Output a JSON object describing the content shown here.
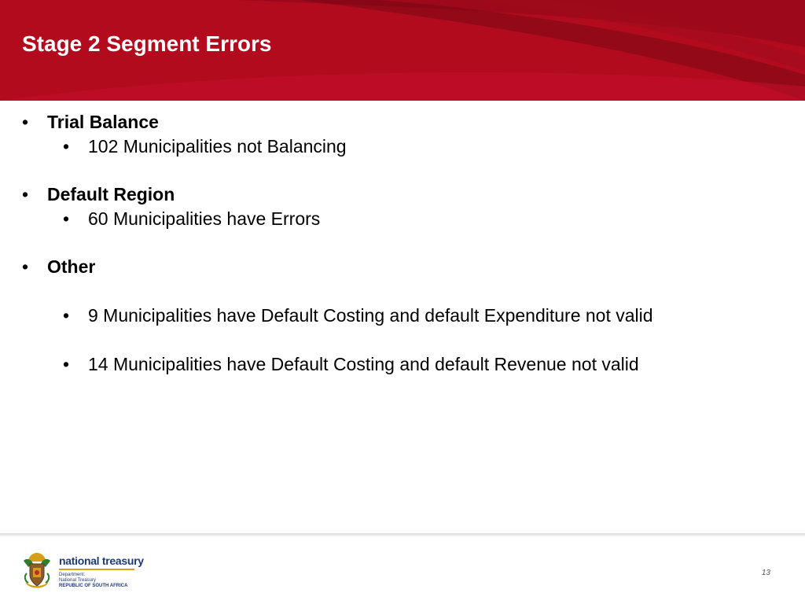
{
  "slide": {
    "title": "Stage 2 Segment Errors",
    "bullet_glyph": "•",
    "items": [
      {
        "heading": "Trial Balance",
        "subitems": [
          "102 Municipalities not Balancing"
        ]
      },
      {
        "heading": "Default Region",
        "subitems": [
          "60 Municipalities have Errors"
        ]
      },
      {
        "heading": "Other",
        "subitems": [
          "9 Municipalities have Default Costing and default Expenditure not valid",
          "14 Municipalities have Default Costing and default Revenue not valid"
        ]
      }
    ]
  },
  "footer": {
    "logo_name": "national treasury",
    "logo_line1": "Department:",
    "logo_line2": "National Treasury",
    "logo_line3": "REPUBLIC OF SOUTH AFRICA",
    "page_number": "13"
  },
  "colors": {
    "header_red": "#b20b1e",
    "header_dark_red": "#8c0a18",
    "logo_blue": "#1f3a72",
    "logo_gold": "#d4a017"
  },
  "icons": {
    "logo": "coat-of-arms-icon"
  }
}
